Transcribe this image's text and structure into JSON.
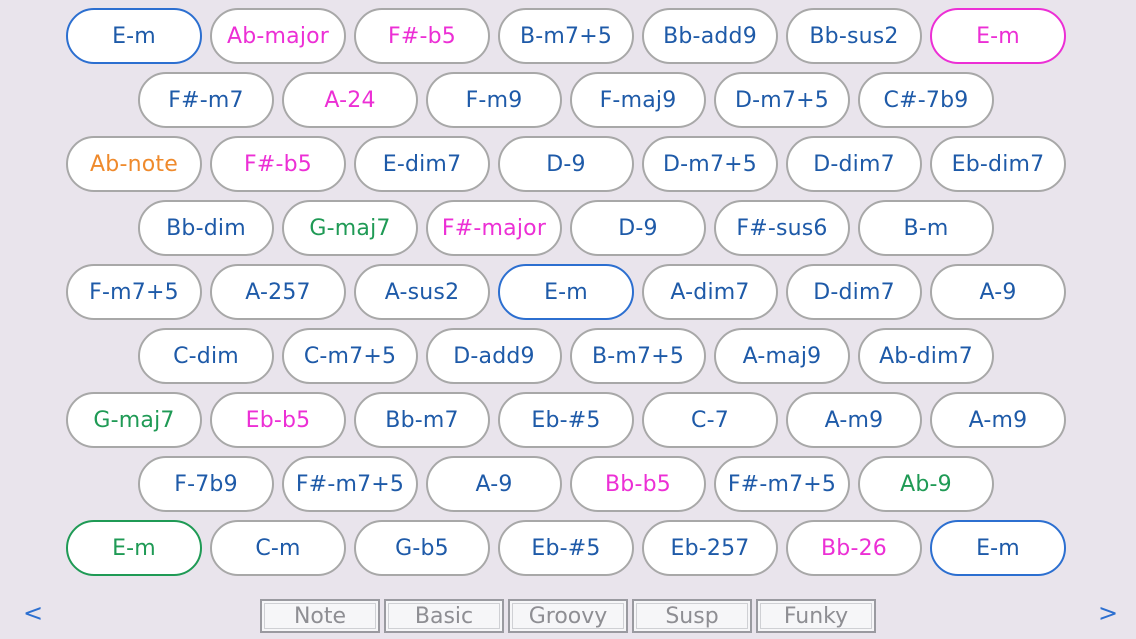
{
  "colors": {
    "blue": "#1e5aa8",
    "pink": "#ec2fd5",
    "green": "#1f9a55",
    "orange": "#ef8a2c",
    "background": "#e9e4ec"
  },
  "rows": [
    [
      {
        "label": "E-m",
        "color": "blue",
        "highlight": "blue"
      },
      {
        "label": "Ab-major",
        "color": "pink"
      },
      {
        "label": "F#-b5",
        "color": "pink"
      },
      {
        "label": "B-m7+5",
        "color": "blue"
      },
      {
        "label": "Bb-add9",
        "color": "blue"
      },
      {
        "label": "Bb-sus2",
        "color": "blue"
      },
      {
        "label": "E-m",
        "color": "pink",
        "highlight": "pink"
      }
    ],
    [
      {
        "label": "F#-m7",
        "color": "blue"
      },
      {
        "label": "A-24",
        "color": "pink"
      },
      {
        "label": "F-m9",
        "color": "blue"
      },
      {
        "label": "F-maj9",
        "color": "blue"
      },
      {
        "label": "D-m7+5",
        "color": "blue"
      },
      {
        "label": "C#-7b9",
        "color": "blue"
      }
    ],
    [
      {
        "label": "Ab-note",
        "color": "orange"
      },
      {
        "label": "F#-b5",
        "color": "pink"
      },
      {
        "label": "E-dim7",
        "color": "blue"
      },
      {
        "label": "D-9",
        "color": "blue"
      },
      {
        "label": "D-m7+5",
        "color": "blue"
      },
      {
        "label": "D-dim7",
        "color": "blue"
      },
      {
        "label": "Eb-dim7",
        "color": "blue"
      }
    ],
    [
      {
        "label": "Bb-dim",
        "color": "blue"
      },
      {
        "label": "G-maj7",
        "color": "green"
      },
      {
        "label": "F#-major",
        "color": "pink"
      },
      {
        "label": "D-9",
        "color": "blue"
      },
      {
        "label": "F#-sus6",
        "color": "blue"
      },
      {
        "label": "B-m",
        "color": "blue"
      }
    ],
    [
      {
        "label": "F-m7+5",
        "color": "blue"
      },
      {
        "label": "A-257",
        "color": "blue"
      },
      {
        "label": "A-sus2",
        "color": "blue"
      },
      {
        "label": "E-m",
        "color": "blue",
        "highlight": "blue"
      },
      {
        "label": "A-dim7",
        "color": "blue"
      },
      {
        "label": "D-dim7",
        "color": "blue"
      },
      {
        "label": "A-9",
        "color": "blue"
      }
    ],
    [
      {
        "label": "C-dim",
        "color": "blue"
      },
      {
        "label": "C-m7+5",
        "color": "blue"
      },
      {
        "label": "D-add9",
        "color": "blue"
      },
      {
        "label": "B-m7+5",
        "color": "blue"
      },
      {
        "label": "A-maj9",
        "color": "blue"
      },
      {
        "label": "Ab-dim7",
        "color": "blue"
      }
    ],
    [
      {
        "label": "G-maj7",
        "color": "green"
      },
      {
        "label": "Eb-b5",
        "color": "pink"
      },
      {
        "label": "Bb-m7",
        "color": "blue"
      },
      {
        "label": "Eb-#5",
        "color": "blue"
      },
      {
        "label": "C-7",
        "color": "blue"
      },
      {
        "label": "A-m9",
        "color": "blue"
      },
      {
        "label": "A-m9",
        "color": "blue"
      }
    ],
    [
      {
        "label": "F-7b9",
        "color": "blue"
      },
      {
        "label": "F#-m7+5",
        "color": "blue"
      },
      {
        "label": "A-9",
        "color": "blue"
      },
      {
        "label": "Bb-b5",
        "color": "pink"
      },
      {
        "label": "F#-m7+5",
        "color": "blue"
      },
      {
        "label": "Ab-9",
        "color": "green"
      }
    ],
    [
      {
        "label": "E-m",
        "color": "green",
        "highlight": "green"
      },
      {
        "label": "C-m",
        "color": "blue"
      },
      {
        "label": "G-b5",
        "color": "blue"
      },
      {
        "label": "Eb-#5",
        "color": "blue"
      },
      {
        "label": "Eb-257",
        "color": "blue"
      },
      {
        "label": "Bb-26",
        "color": "pink"
      },
      {
        "label": "E-m",
        "color": "blue",
        "highlight": "blue"
      }
    ]
  ],
  "nav": {
    "prev": "<",
    "next": ">"
  },
  "tabs": [
    "Note",
    "Basic",
    "Groovy",
    "Susp",
    "Funky"
  ]
}
